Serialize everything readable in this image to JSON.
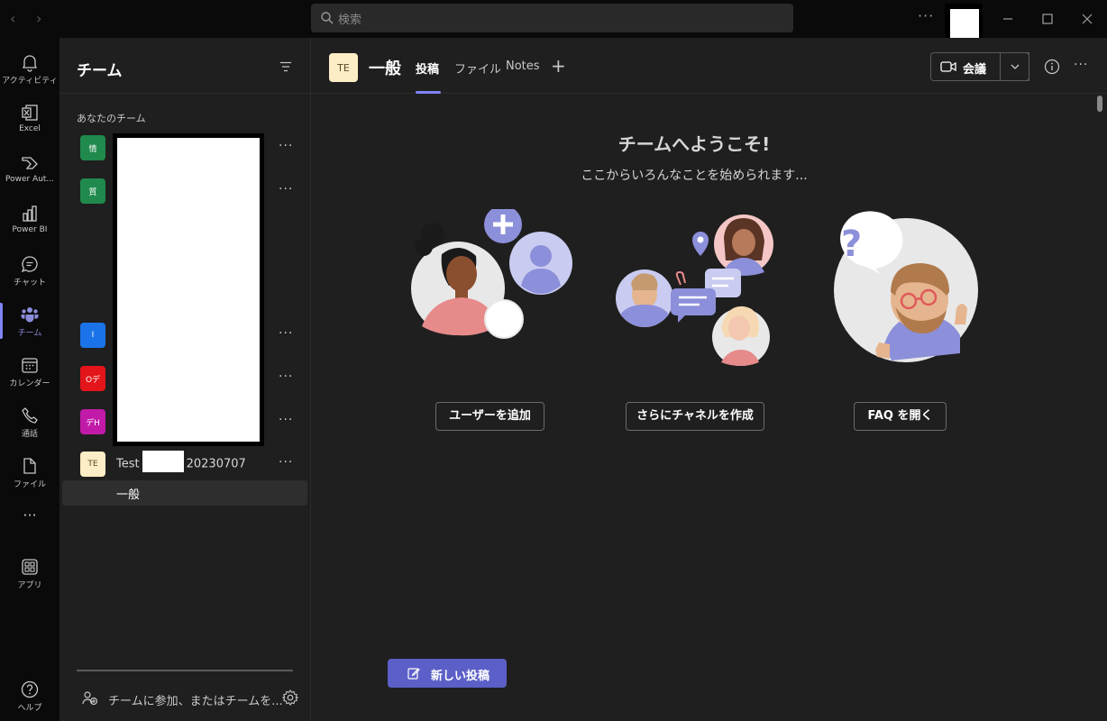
{
  "titlebar": {
    "search_placeholder": "検索",
    "more": "···"
  },
  "rail": {
    "items": [
      {
        "label": "アクティビティ",
        "icon": "bell-icon"
      },
      {
        "label": "Excel",
        "icon": "excel-icon"
      },
      {
        "label": "Power Aut...",
        "icon": "power-automate-icon"
      },
      {
        "label": "Power BI",
        "icon": "power-bi-icon"
      },
      {
        "label": "チャット",
        "icon": "chat-icon"
      },
      {
        "label": "チーム",
        "icon": "teams-icon",
        "active": true
      },
      {
        "label": "カレンダー",
        "icon": "calendar-icon"
      },
      {
        "label": "通話",
        "icon": "phone-icon"
      },
      {
        "label": "ファイル",
        "icon": "file-icon"
      },
      {
        "label": "···",
        "icon": "more-icon"
      },
      {
        "label": "アプリ",
        "icon": "apps-icon"
      },
      {
        "label": "ヘルプ",
        "icon": "help-icon"
      }
    ]
  },
  "panel": {
    "title": "チーム",
    "section_label": "あなたのチーム",
    "teams": [
      {
        "avatar": "情",
        "color": "#1f8a4c"
      },
      {
        "avatar": "質",
        "color": "#1f8a4c"
      },
      {
        "avatar": "I",
        "color": "#1a73e8"
      },
      {
        "avatar": "Oデ",
        "color": "#e3151a"
      },
      {
        "avatar": "デH",
        "color": "#c21aa8"
      }
    ],
    "test_team": {
      "avatar": "TE",
      "name_prefix": "Test",
      "name_suffix": "20230707"
    },
    "channel": "一般",
    "join_label": "チームに参加、またはチームを..."
  },
  "main": {
    "channel_avatar": "TE",
    "channel_title": "一般",
    "tabs": [
      "投稿",
      "ファイル",
      "Notes"
    ],
    "meet_label": "会議",
    "welcome_title": "チームへようこそ!",
    "welcome_sub": "ここからいろんなことを始められます...",
    "actions": [
      "ユーザーを追加",
      "さらにチャネルを作成",
      "FAQ を開く"
    ],
    "new_post": "新しい投稿"
  },
  "colors": {
    "accent": "#5b5fc7",
    "accent_light": "#7f85f5",
    "background": "#1f1f1f",
    "rail": "#0a0a0a"
  }
}
